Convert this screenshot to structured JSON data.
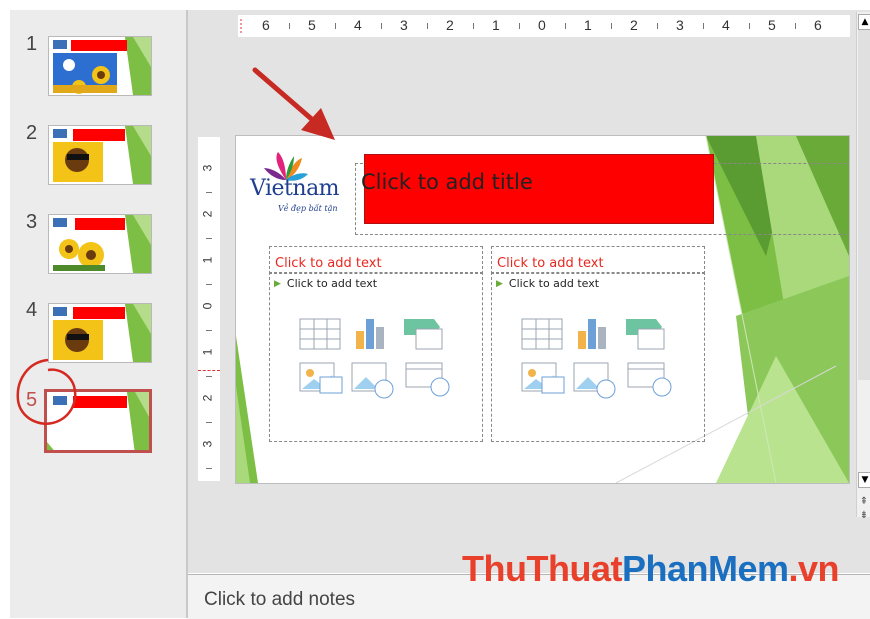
{
  "thumbnails": [
    {
      "number": "1",
      "selected": false
    },
    {
      "number": "2",
      "selected": false
    },
    {
      "number": "3",
      "selected": false
    },
    {
      "number": "4",
      "selected": false
    },
    {
      "number": "5",
      "selected": true
    }
  ],
  "ruler_horizontal": [
    "6",
    "5",
    "4",
    "3",
    "2",
    "1",
    "0",
    "1",
    "2",
    "3",
    "4",
    "5",
    "6"
  ],
  "ruler_vertical": [
    "3",
    "2",
    "1",
    "0",
    "1",
    "2",
    "3"
  ],
  "slide": {
    "logo_text": "Vietnam",
    "logo_tagline": "Vẻ đẹp bất tận",
    "title_placeholder": "Click to add title",
    "left_content": {
      "heading": "Click to add text",
      "bullet": "Click to add text"
    },
    "right_content": {
      "heading": "Click to add text",
      "bullet": "Click to add text"
    }
  },
  "notes_placeholder": "Click to add notes",
  "watermark": "ThuThuatPhanMem.vn",
  "colors": {
    "title_fill": "#ff0000",
    "selection_red": "#c0504d",
    "green_dark": "#5a9b32",
    "green_light": "#a9d97b"
  }
}
